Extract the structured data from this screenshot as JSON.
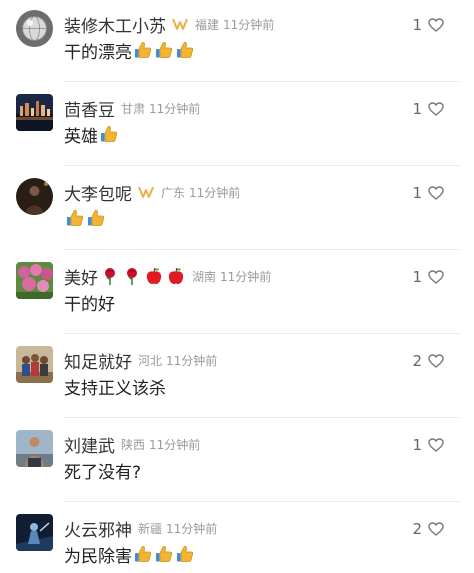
{
  "comments": [
    {
      "name": "装修木工小苏",
      "badge": true,
      "decorations": [],
      "region": "福建",
      "time": "11分钟前",
      "text": "干的漂亮",
      "thumbs": 3,
      "likes": "1",
      "avatar": "globe"
    },
    {
      "name": "茴香豆",
      "badge": false,
      "decorations": [],
      "region": "甘肃",
      "time": "11分钟前",
      "text": "英雄",
      "thumbs": 1,
      "likes": "1",
      "avatar": "citynight"
    },
    {
      "name": "大李包呢",
      "badge": true,
      "decorations": [],
      "region": "广东",
      "time": "11分钟前",
      "text": "",
      "thumbs": 2,
      "likes": "1",
      "avatar": "dark"
    },
    {
      "name": "美好",
      "badge": false,
      "decorations": [
        "rose-icon",
        "rose-icon",
        "apple-icon",
        "apple-icon"
      ],
      "region": "湖南",
      "time": "11分钟前",
      "text": "干的好",
      "thumbs": 0,
      "likes": "1",
      "avatar": "flowers"
    },
    {
      "name": "知足就好",
      "badge": false,
      "decorations": [],
      "region": "河北",
      "time": "11分钟前",
      "text": "支持正义该杀",
      "thumbs": 0,
      "likes": "2",
      "avatar": "people"
    },
    {
      "name": "刘建武",
      "badge": false,
      "decorations": [],
      "region": "陕西",
      "time": "11分钟前",
      "text": "死了没有?",
      "thumbs": 0,
      "likes": "1",
      "avatar": "man"
    },
    {
      "name": "火云邪神",
      "badge": false,
      "decorations": [],
      "region": "新疆",
      "time": "11分钟前",
      "text": "为民除害",
      "thumbs": 3,
      "likes": "2",
      "avatar": "scifi"
    }
  ],
  "colors": {
    "name": "#333333",
    "meta": "#9a9a9a",
    "text": "#222222",
    "thumb": "#f2b533",
    "badge": "#e8b14a"
  }
}
